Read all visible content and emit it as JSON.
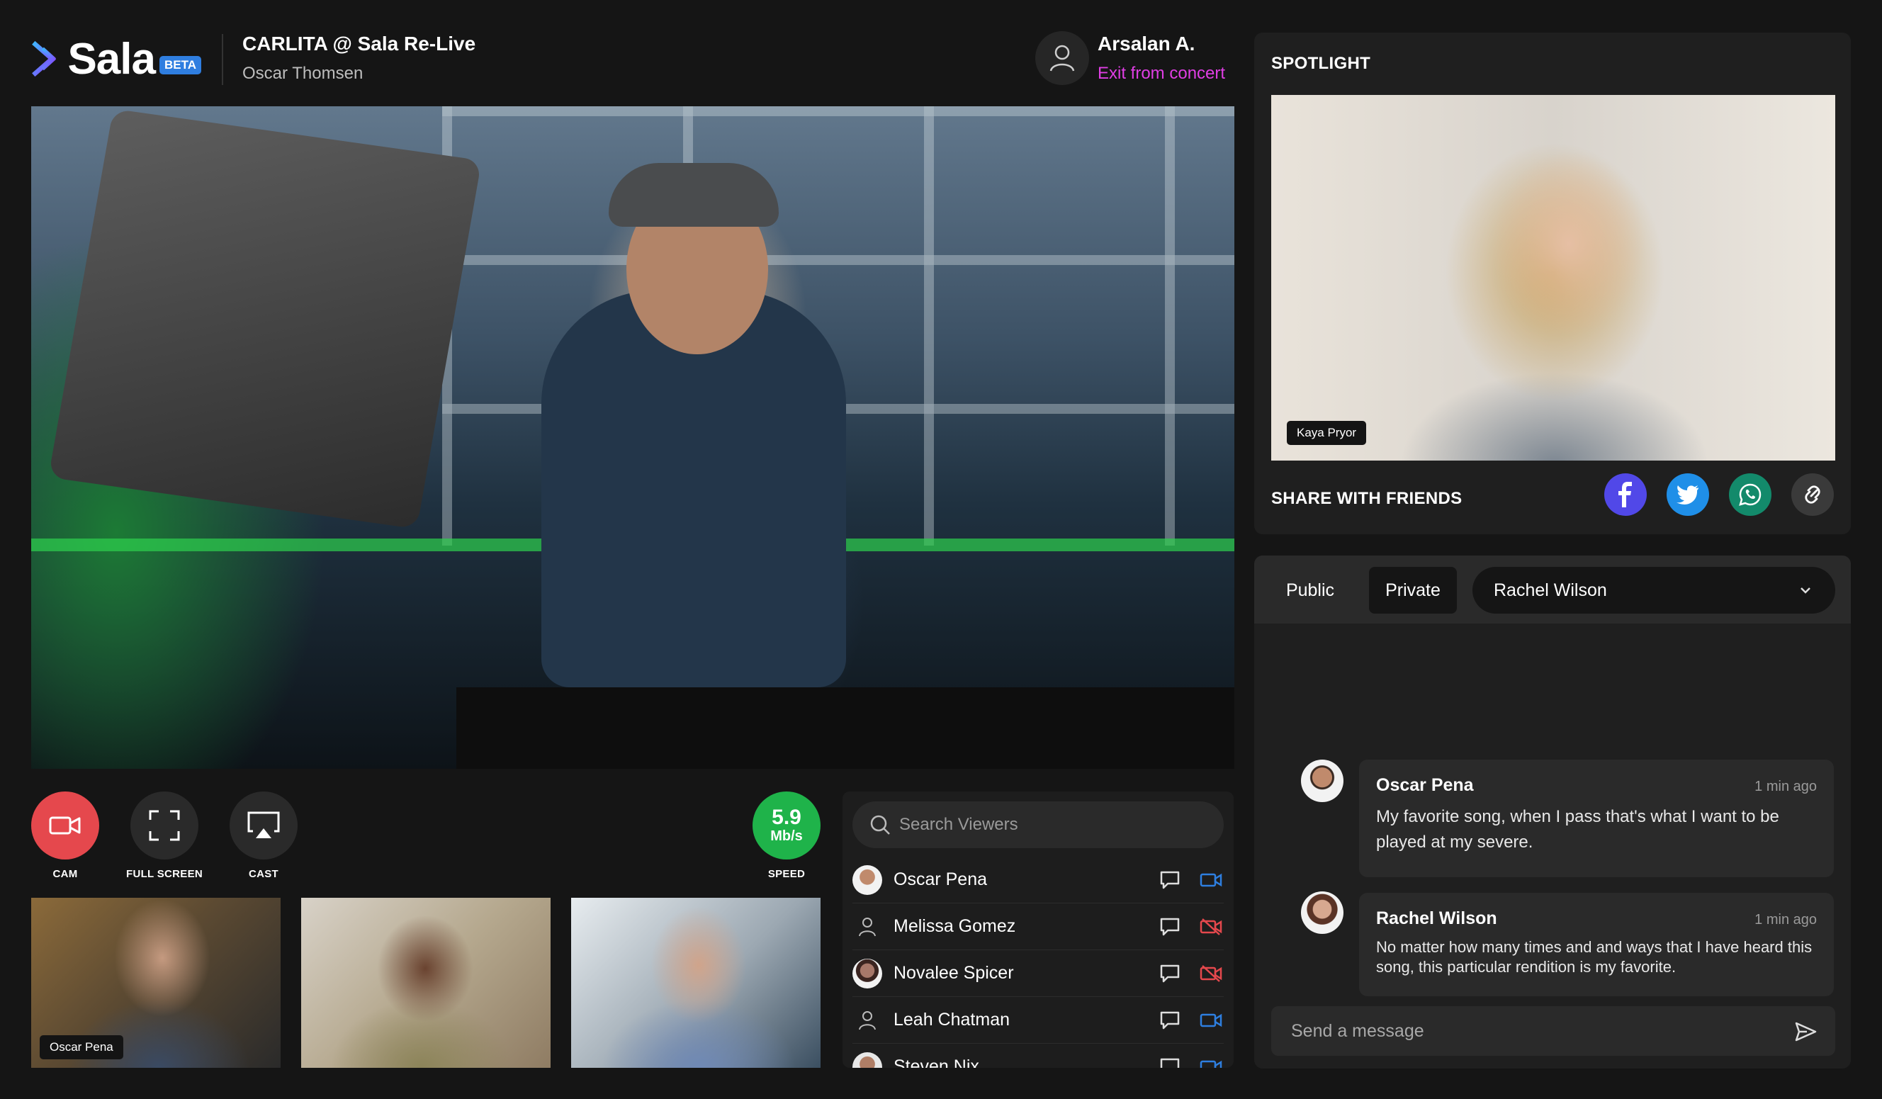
{
  "brand": {
    "name": "Sala",
    "badge": "BETA"
  },
  "event": {
    "title": "CARLITA @ Sala Re-Live",
    "artist": "Oscar Thomsen"
  },
  "user": {
    "name": "Arsalan A.",
    "exit_label": "Exit from concert"
  },
  "controls": {
    "cam": "CAM",
    "fullscreen": "FULL SCREEN",
    "cast": "CAST"
  },
  "speed": {
    "value": "5.9",
    "unit": "Mb/s",
    "label": "SPEED"
  },
  "thumbnails": [
    {
      "name": "Oscar Pena"
    }
  ],
  "viewers": {
    "search_placeholder": "Search Viewers",
    "items": [
      {
        "name": "Oscar Pena",
        "camera": "on"
      },
      {
        "name": "Melissa Gomez",
        "camera": "off"
      },
      {
        "name": "Novalee Spicer",
        "camera": "off"
      },
      {
        "name": "Leah Chatman",
        "camera": "on"
      },
      {
        "name": "Steven Nix",
        "camera": "on"
      }
    ]
  },
  "spotlight": {
    "title": "SPOTLIGHT",
    "presenter": "Kaya Pryor",
    "share_title": "SHARE WITH FRIENDS",
    "share_icons": [
      "facebook-icon",
      "twitter-icon",
      "whatsapp-icon",
      "link-icon"
    ]
  },
  "chat": {
    "tabs": [
      "Public",
      "Private"
    ],
    "active_tab": "Private",
    "recipient": "Rachel Wilson",
    "messages": [
      {
        "name": "Oscar Pena",
        "time": "1 min ago",
        "text": "My favorite song, when I pass that's what I want to be played at my severe."
      },
      {
        "name": "Rachel Wilson",
        "time": "1 min ago",
        "text": "No matter how many times and and ways that I have heard this song, this particular rendition is my favorite."
      }
    ],
    "input_placeholder": "Send a message"
  },
  "colors": {
    "accent_pink": "#e03ee4",
    "cam_red": "#e5484d",
    "speed_green": "#1fb34a",
    "cam_on_blue": "#2e7fe0",
    "cam_off_red": "#e5484d"
  }
}
